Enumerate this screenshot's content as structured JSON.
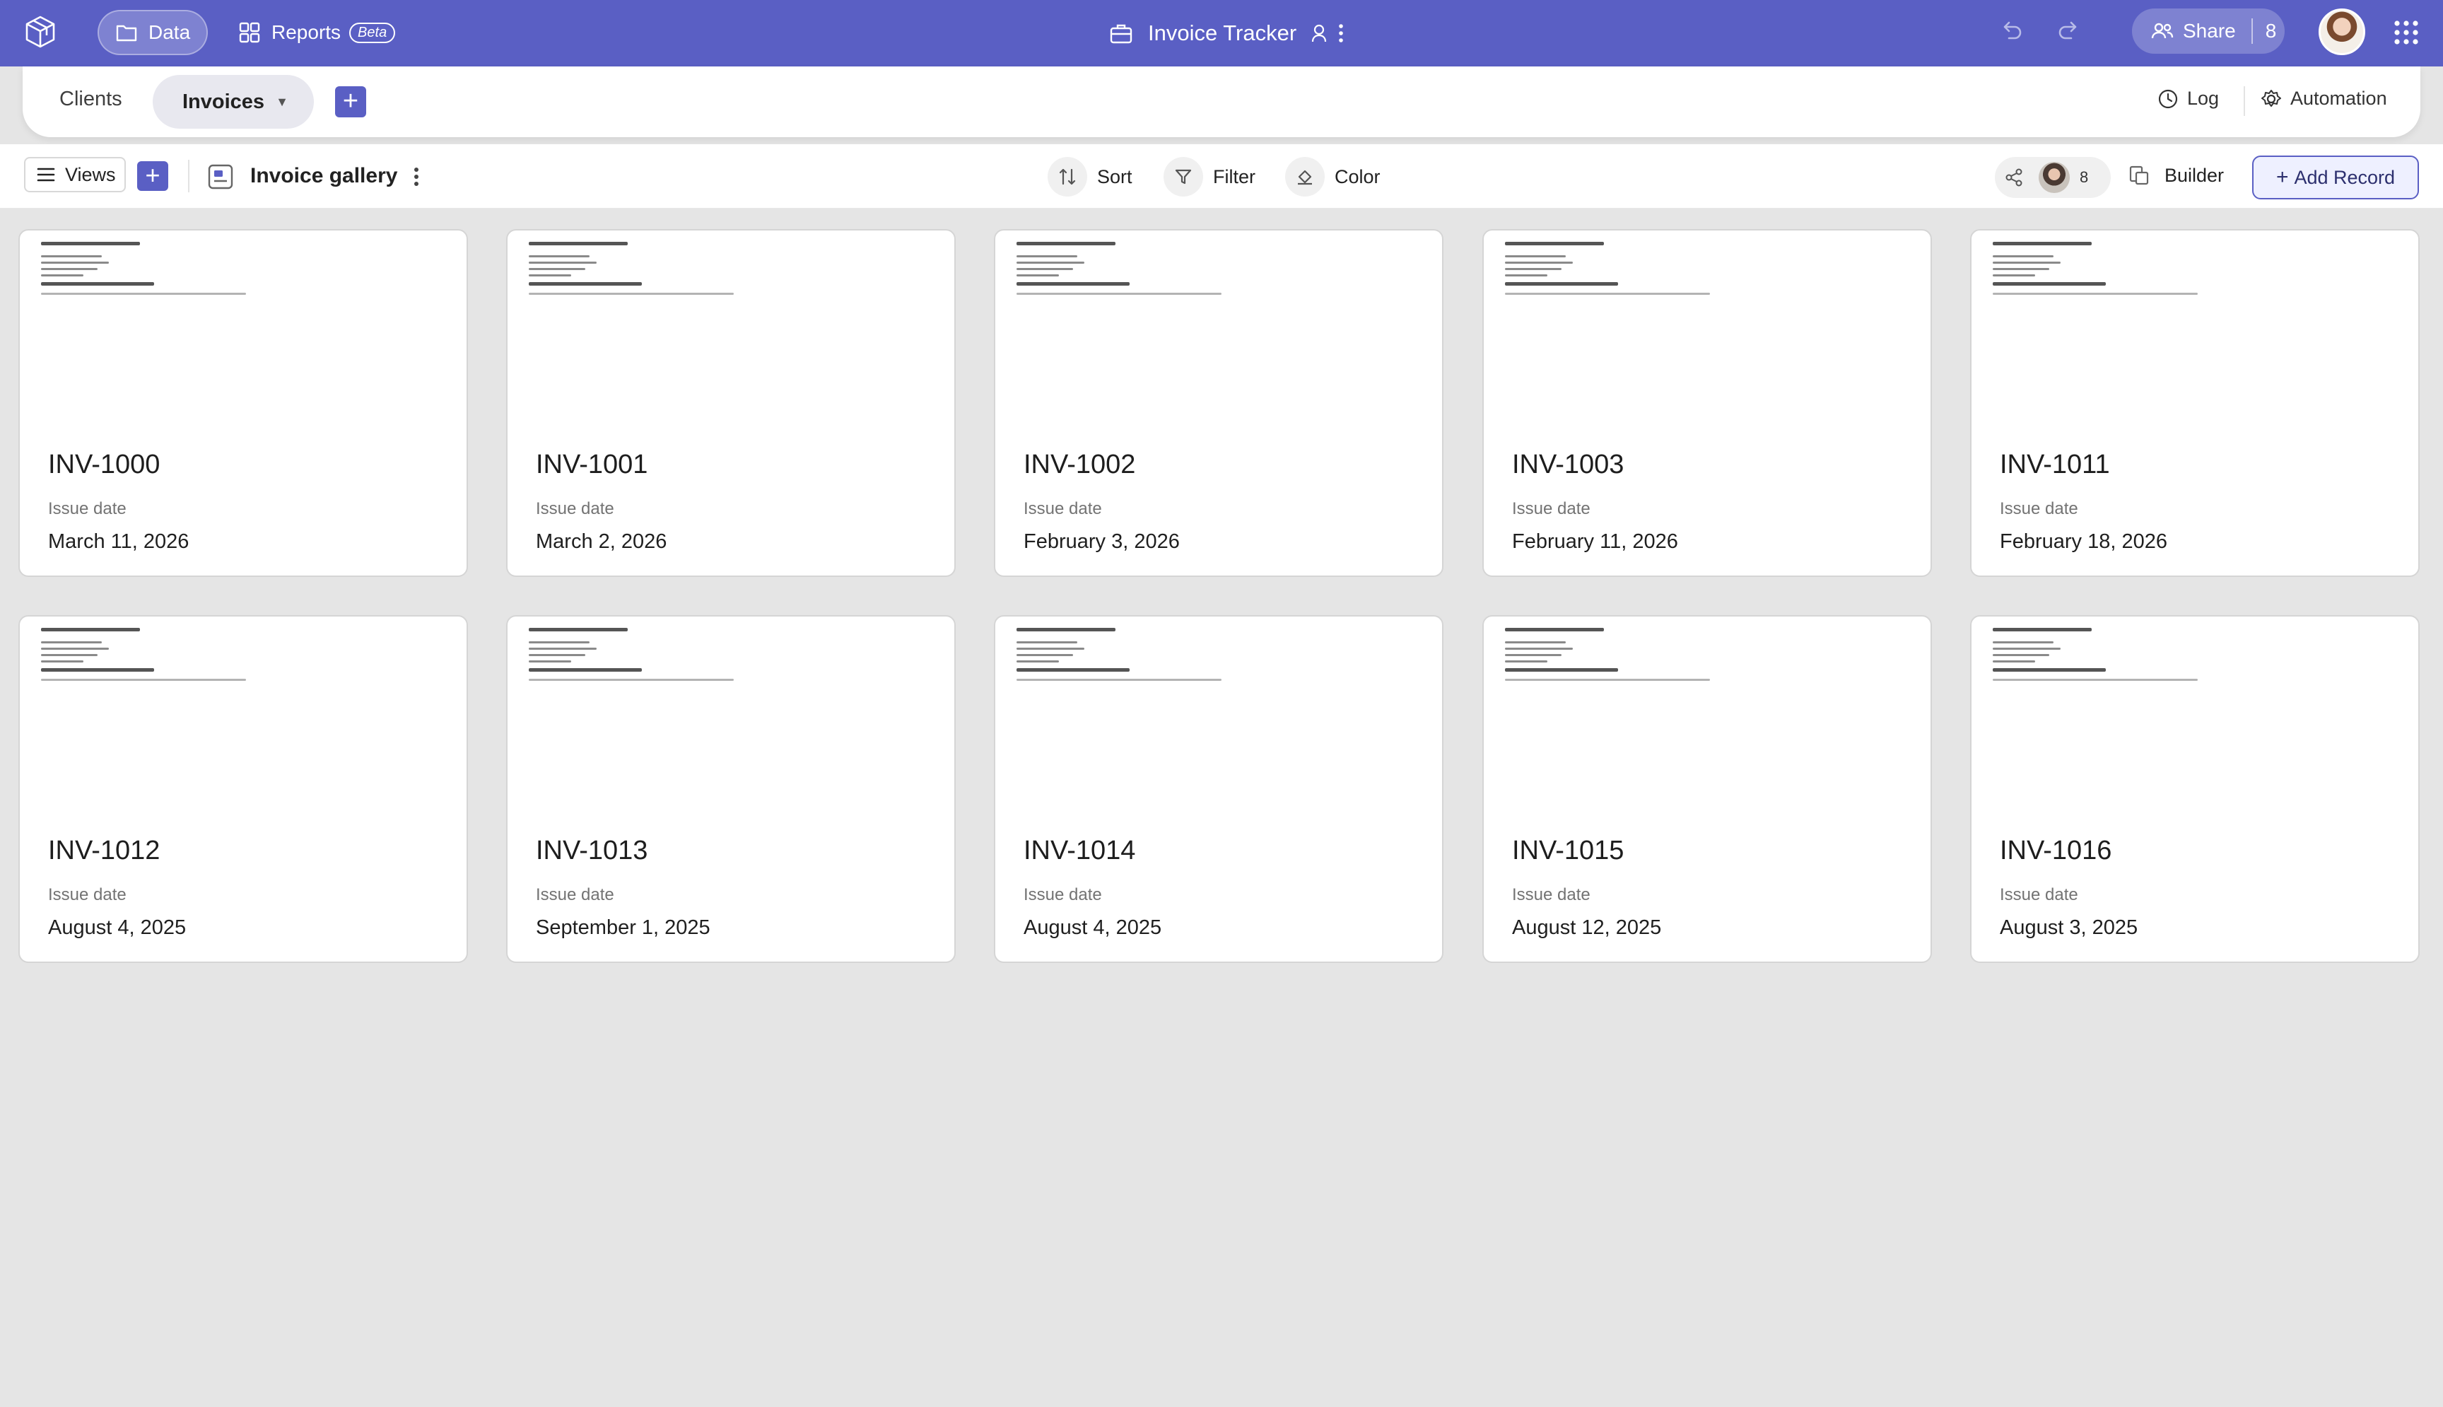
{
  "topbar": {
    "nav": [
      {
        "label": "Data",
        "icon": "folder-icon"
      },
      {
        "label": "Reports",
        "icon": "grid-icon",
        "badge": "Beta"
      }
    ],
    "title": "Invoice Tracker",
    "share_label": "Share",
    "share_count": "8"
  },
  "tabs": {
    "items": [
      {
        "label": "Clients"
      },
      {
        "label": "Invoices",
        "active": true
      }
    ],
    "log_label": "Log",
    "automation_label": "Automation"
  },
  "toolbar": {
    "views_label": "Views",
    "view_name": "Invoice gallery",
    "sort_label": "Sort",
    "filter_label": "Filter",
    "color_label": "Color",
    "collaborators_count": "8",
    "builder_label": "Builder",
    "add_record_label": "Add Record"
  },
  "gallery": {
    "field_label": "Issue date",
    "cards": [
      {
        "name": "INV-1000",
        "date": "March 11, 2026"
      },
      {
        "name": "INV-1001",
        "date": "March 2, 2026"
      },
      {
        "name": "INV-1002",
        "date": "February 3, 2026"
      },
      {
        "name": "INV-1003",
        "date": "February 11, 2026"
      },
      {
        "name": "INV-1011",
        "date": "February 18, 2026"
      },
      {
        "name": "INV-1012",
        "date": "August 4, 2025"
      },
      {
        "name": "INV-1013",
        "date": "September 1, 2025"
      },
      {
        "name": "INV-1014",
        "date": "August 4, 2025"
      },
      {
        "name": "INV-1015",
        "date": "August 12, 2025"
      },
      {
        "name": "INV-1016",
        "date": "August 3, 2025"
      }
    ]
  },
  "colors": {
    "brand": "#5a5fc4",
    "background": "#e5e5e5"
  }
}
